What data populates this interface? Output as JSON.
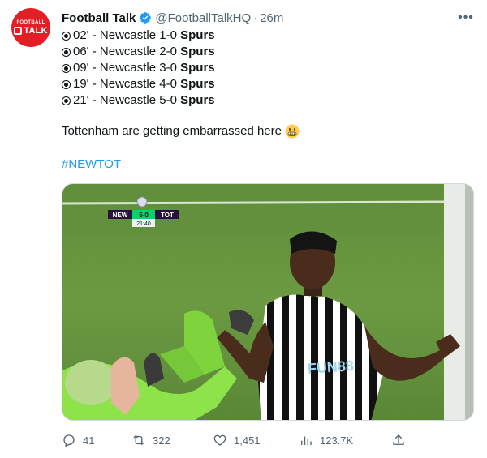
{
  "author": {
    "display_name": "Football Talk",
    "handle": "@FootballTalkHQ",
    "separator": "·",
    "time": "26m",
    "avatar_text_small": "FOOTBALL",
    "avatar_text_big": "TALK"
  },
  "goals": [
    {
      "minute": "02'",
      "text": " - Newcastle 1-0 ",
      "team": "Spurs"
    },
    {
      "minute": "06'",
      "text": " - Newcastle 2-0 ",
      "team": "Spurs"
    },
    {
      "minute": "09'",
      "text": " - Newcastle 3-0 ",
      "team": "Spurs"
    },
    {
      "minute": "19'",
      "text": " - Newcastle 4-0 ",
      "team": "Spurs"
    },
    {
      "minute": "21'",
      "text": " - Newcastle 5-0 ",
      "team": "Spurs"
    }
  ],
  "body_text": "Tottenham are getting embarrassed here",
  "hashtag": "#NEWTOT",
  "media": {
    "scoreboard": {
      "home": "NEW",
      "score": "5-0",
      "away": "TOT",
      "clock": "21:40"
    },
    "shirt_sponsor": "FUN88"
  },
  "actions": {
    "replies": "41",
    "retweets": "322",
    "likes": "1,451",
    "views": "123.7K"
  },
  "colors": {
    "brand_red": "#e31e24",
    "link_blue": "#1d9bf0",
    "verified_blue": "#1d9bf0",
    "muted": "#536471"
  }
}
